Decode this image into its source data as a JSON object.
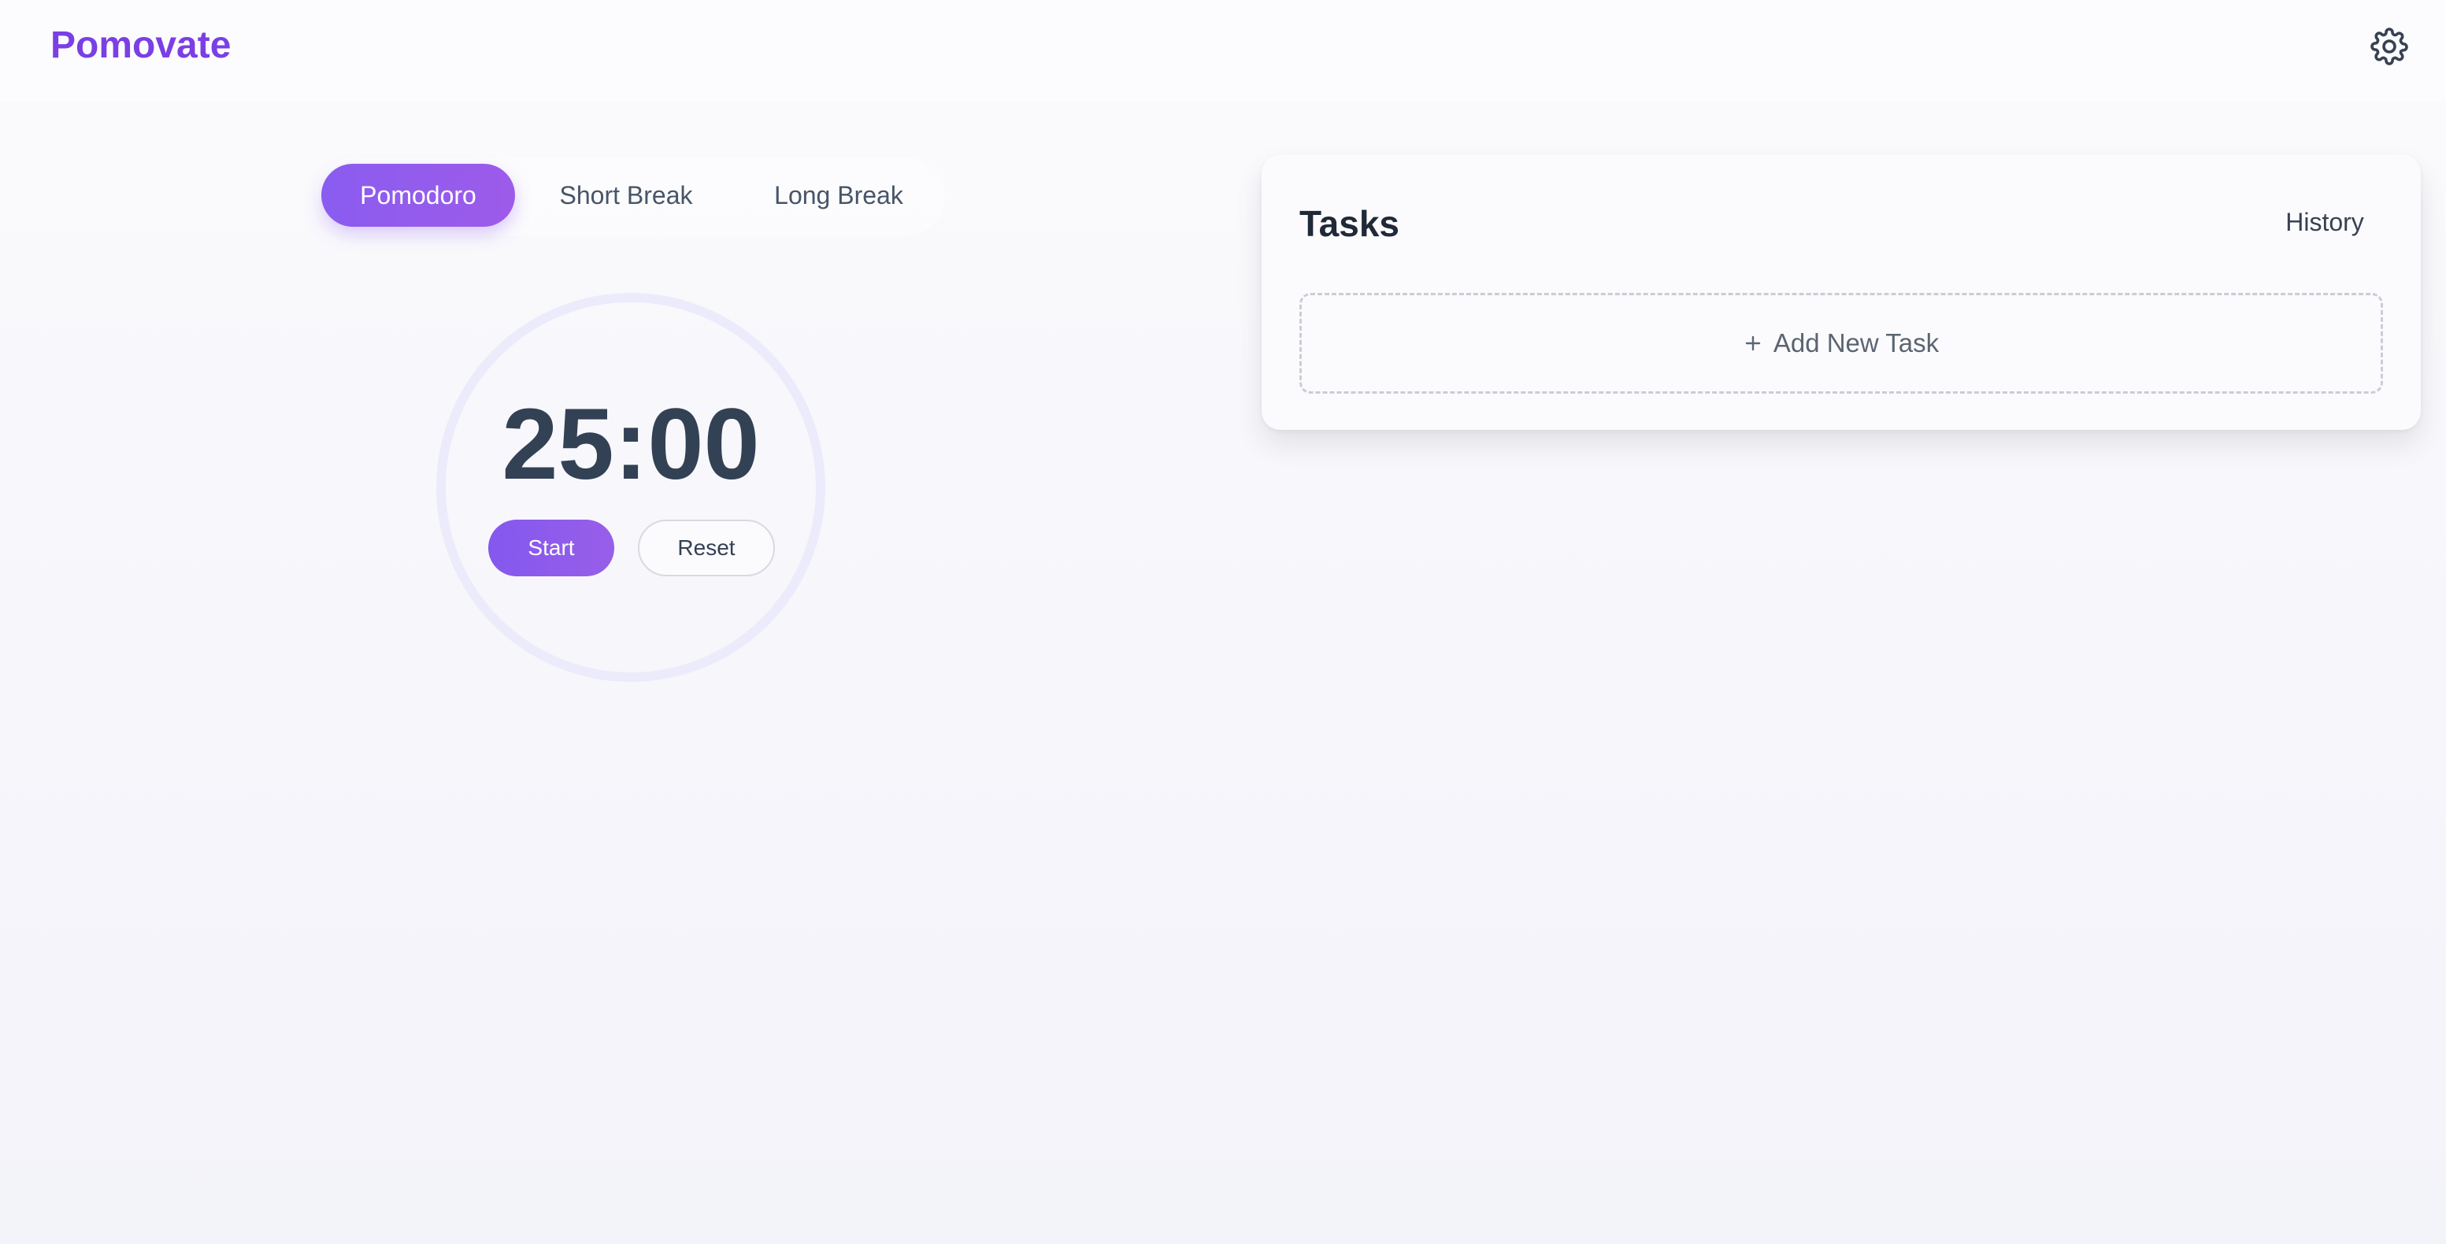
{
  "app": {
    "brand": "Pomovate",
    "accent_color": "#7b3fe4"
  },
  "header": {
    "settings_icon": "gear-icon"
  },
  "timer": {
    "tabs": [
      {
        "label": "Pomodoro",
        "active": true
      },
      {
        "label": "Short Break",
        "active": false
      },
      {
        "label": "Long Break",
        "active": false
      }
    ],
    "time": "25:00",
    "start_label": "Start",
    "reset_label": "Reset",
    "progress": 0
  },
  "tasks": {
    "title": "Tasks",
    "history_label": "History",
    "add_task_label": "Add New Task",
    "add_icon": "plus-icon"
  }
}
